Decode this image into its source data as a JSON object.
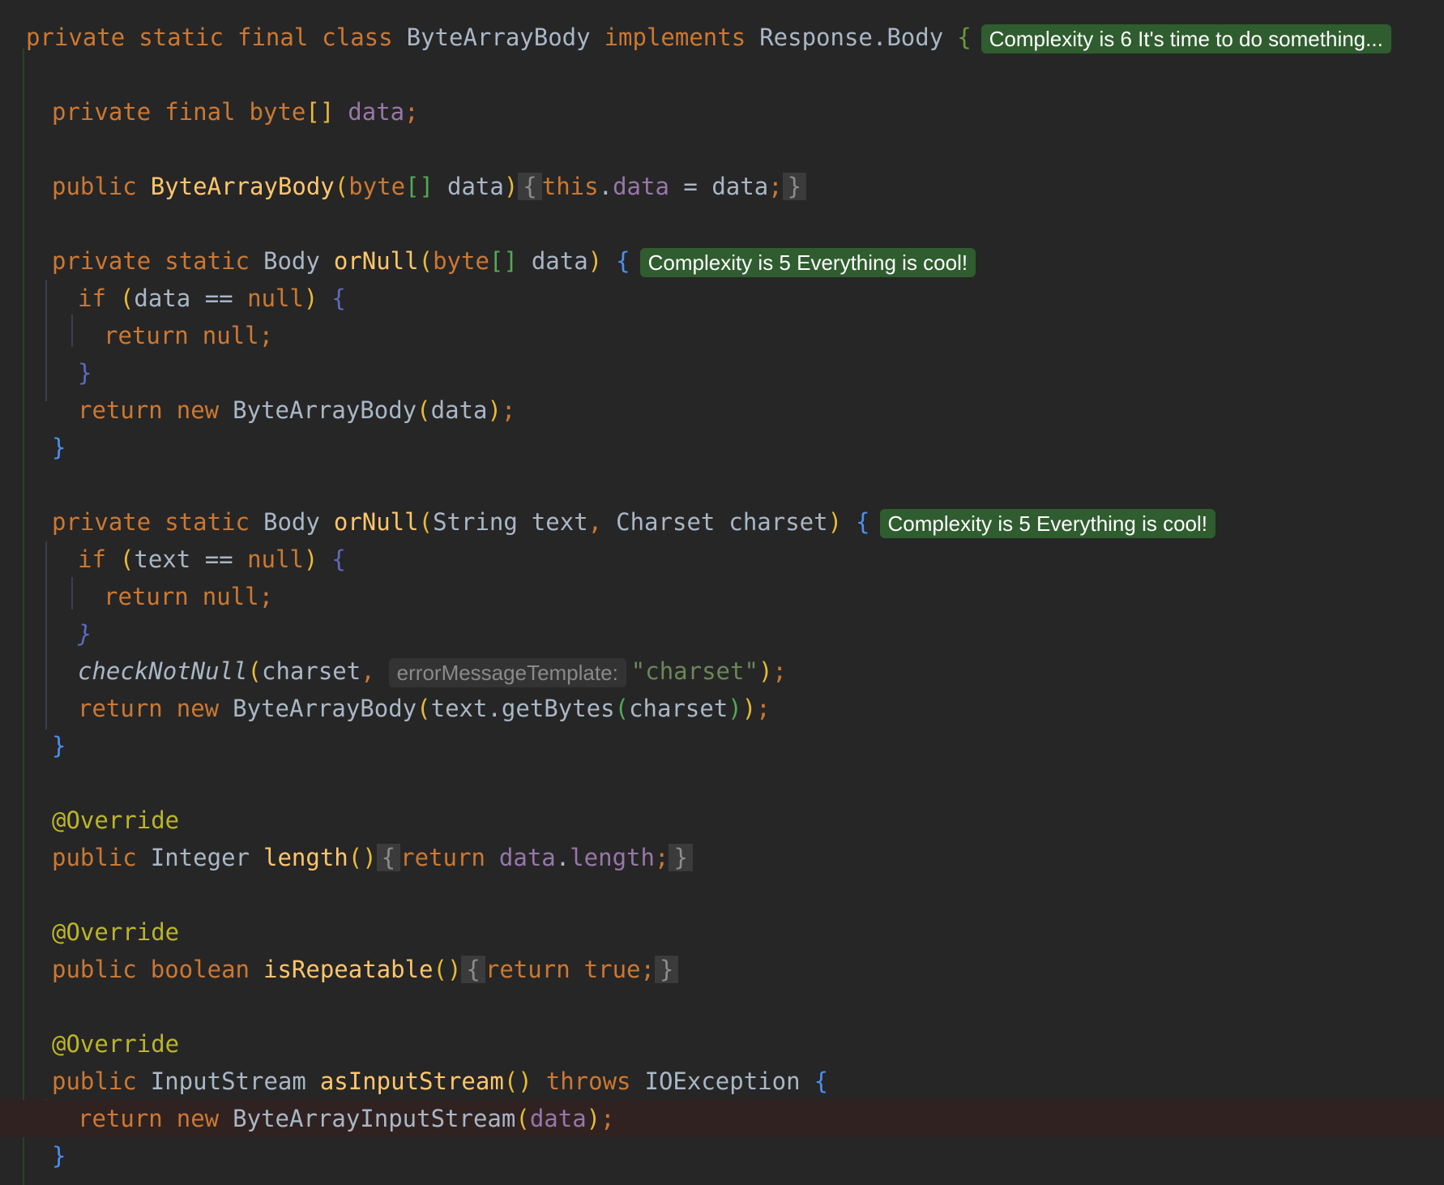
{
  "code": {
    "l1": {
      "private": "private",
      "static": "static",
      "final": "final",
      "class": "class",
      "name": "ByteArrayBody",
      "implements": "implements",
      "iface": "Response.Body",
      "open": "{",
      "badge": "Complexity is 6 It's time to do something..."
    },
    "l2": {
      "private": "private",
      "final": "final",
      "type": "byte",
      "arr": "[]",
      "field": "data",
      "semi": ";"
    },
    "l3": {
      "public": "public",
      "name": "ByteArrayBody",
      "lp": "(",
      "ptype": "byte",
      "arr": "[]",
      "param": "data",
      "rp": ")",
      "fopen": "{",
      "this": "this",
      "dot": ".",
      "field": "data",
      "assign": " = ",
      "val": "data",
      "semi": ";",
      "fclose": "}"
    },
    "m1": {
      "private": "private",
      "static": "static",
      "rtype": "Body",
      "name": "orNull",
      "lp": "(",
      "ptype": "byte",
      "arr": "[]",
      "param": "data",
      "rp": ")",
      "open": "{",
      "badge": "Complexity is 5 Everything is cool!",
      "if": "if",
      "ilp": "(",
      "cond": "data == ",
      "null": "null",
      "irp": ")",
      "iopen": "{",
      "return": "return",
      "rnull": "null",
      "rsemi": ";",
      "iclose": "}",
      "return2": "return",
      "new": "new",
      "ctor": "ByteArrayBody",
      "clp": "(",
      "carg": "data",
      "crp": ")",
      "csemi": ";",
      "close": "}"
    },
    "m2": {
      "private": "private",
      "static": "static",
      "rtype": "Body",
      "name": "orNull",
      "lp": "(",
      "p1type": "String",
      "p1": "text",
      "comma": ",",
      "p2type": "Charset",
      "p2": "charset",
      "rp": ")",
      "open": "{",
      "badge": "Complexity is 5 Everything is cool!",
      "if": "if",
      "ilp": "(",
      "cond": "text == ",
      "null": "null",
      "irp": ")",
      "iopen": "{",
      "return": "return",
      "rnull": "null",
      "rsemi": ";",
      "iclose": "}",
      "check": "checkNotNull",
      "klp": "(",
      "karg": "charset",
      "kcomma": ",",
      "hint": "errorMessageTemplate:",
      "str": "\"charset\"",
      "krp": ")",
      "ksemi": ";",
      "return2": "return",
      "new": "new",
      "ctor": "ByteArrayBody",
      "clp": "(",
      "obj": "text",
      "dot": ".",
      "call": "getBytes",
      "glp": "(",
      "garg": "charset",
      "grp": ")",
      "crp": ")",
      "csemi": ";",
      "close": "}"
    },
    "m3": {
      "ann": "@Override",
      "public": "public",
      "rtype": "Integer",
      "name": "length",
      "parens": "()",
      "fopen": "{",
      "return": "return",
      "field": "data",
      "dot": ".",
      "prop": "length",
      "semi": ";",
      "fclose": "}"
    },
    "m4": {
      "ann": "@Override",
      "public": "public",
      "rtype": "boolean",
      "name": "isRepeatable",
      "parens": "()",
      "fopen": "{",
      "return": "return",
      "val": "true",
      "semi": ";",
      "fclose": "}"
    },
    "m5": {
      "ann": "@Override",
      "public": "public",
      "rtype": "InputStream",
      "name": "asInputStream",
      "parens": "()",
      "throws": "throws",
      "ex": "IOException",
      "open": "{",
      "return": "return",
      "new": "new",
      "ctor": "ByteArrayInputStream",
      "lp": "(",
      "arg": "data",
      "rp": ")",
      "semi": ";",
      "close": "}"
    }
  }
}
